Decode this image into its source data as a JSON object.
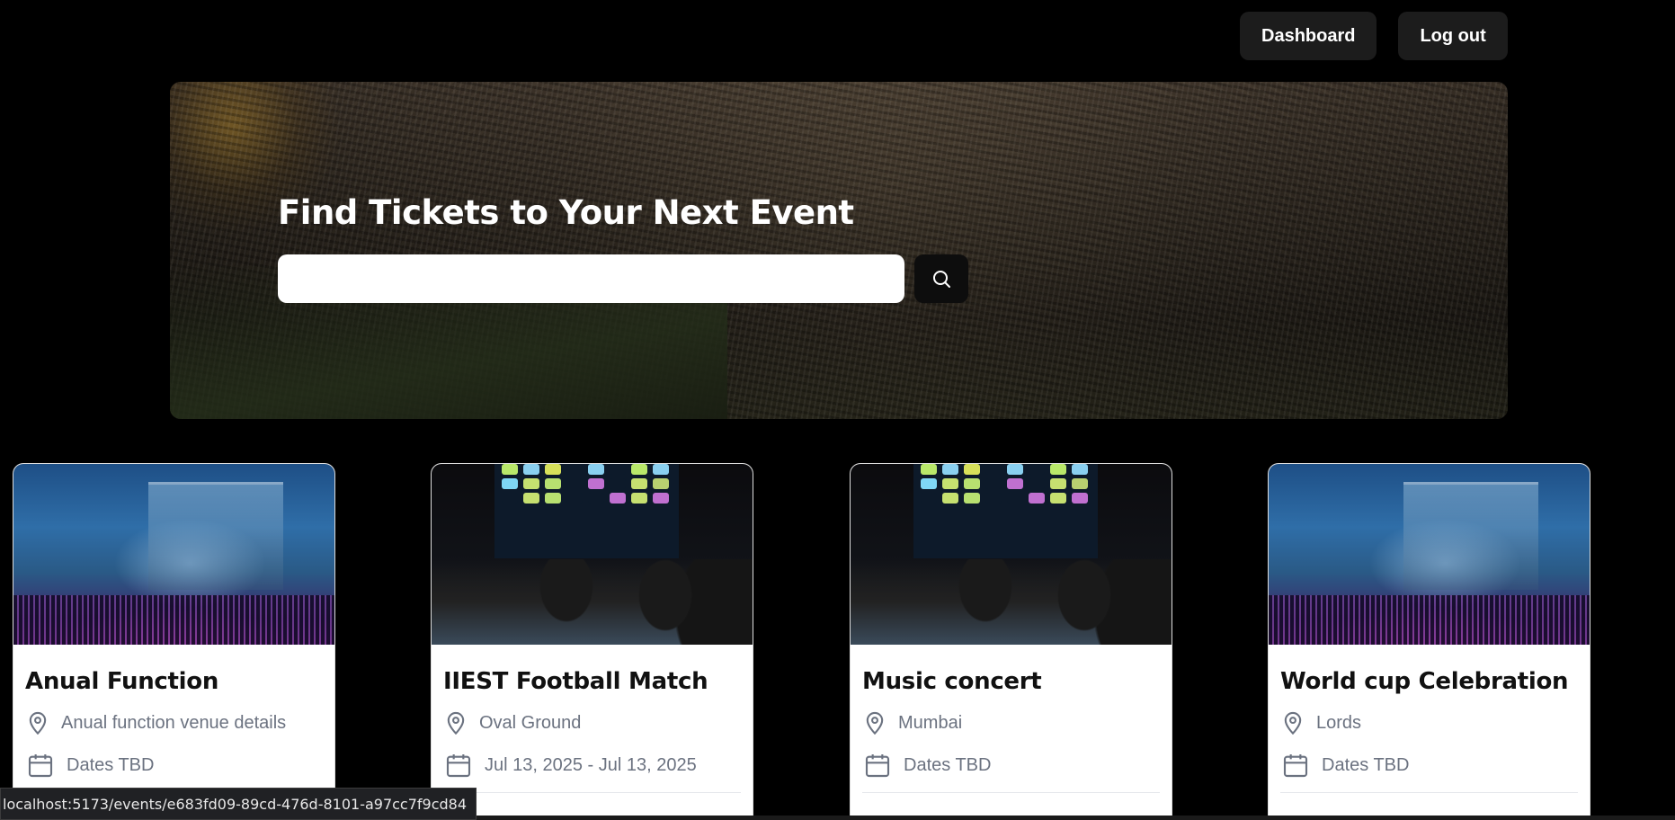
{
  "header": {
    "dashboard_label": "Dashboard",
    "logout_label": "Log out"
  },
  "hero": {
    "title": "Find Tickets to Your Next Event",
    "search_value": "",
    "search_icon": "search-icon"
  },
  "events": [
    {
      "title": "Anual Function",
      "location": "Anual function venue details",
      "dates": "Dates TBD",
      "image": "concert"
    },
    {
      "title": "IIEST Football Match",
      "location": "Oval Ground",
      "dates": "Jul 13, 2025 - Jul 13, 2025",
      "image": "theater"
    },
    {
      "title": "Music concert",
      "location": "Mumbai",
      "dates": "Dates TBD",
      "image": "theater"
    },
    {
      "title": "World cup Celebration",
      "location": "Lords",
      "dates": "Dates TBD",
      "image": "concert"
    }
  ],
  "status_bar": {
    "url": "localhost:5173/events/e683fd09-89cd-476d-8101-a97cc7f9cd84"
  }
}
